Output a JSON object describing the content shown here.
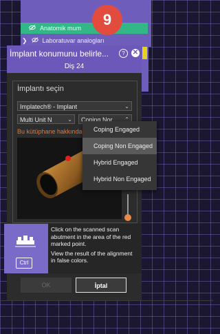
{
  "step_badge": "9",
  "tree": {
    "active_item": "Anatomik mum",
    "next_item": "Laboratuvar analogları"
  },
  "dialog": {
    "title": "İmplant konumunu belirle...",
    "subtitle": "Diş 24",
    "section_label": "İmplantı seçin",
    "library_select": "Implatech® - Implant",
    "type_select": "Multi Unit N",
    "connection_select": "Coping Nor",
    "warning": "Bu kütüphane hakkında",
    "info_line1": "Click on the scanned scan abutment in the area of the red marked point.",
    "info_line2": "View the result of the alignment in false colors.",
    "ctrl_key": "Ctrl",
    "ok_label": "OK",
    "cancel_label": "İptal"
  },
  "dropdown": {
    "options": [
      "Coping Engaged",
      "Coping Non Engaged",
      "Hybrid Engaged",
      "Hybrid Non Engaged"
    ],
    "selected": "Coping Non Engaged"
  },
  "colors": {
    "accent_purple": "#6b58b8",
    "active_green": "#33b787",
    "badge_red": "#e24c3e",
    "warning_orange": "#e0783a"
  }
}
